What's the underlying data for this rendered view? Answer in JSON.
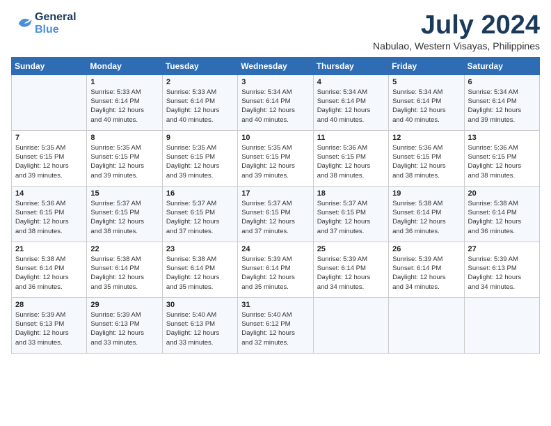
{
  "header": {
    "logo_line1": "General",
    "logo_line2": "Blue",
    "month_title": "July 2024",
    "location": "Nabulao, Western Visayas, Philippines"
  },
  "days_of_week": [
    "Sunday",
    "Monday",
    "Tuesday",
    "Wednesday",
    "Thursday",
    "Friday",
    "Saturday"
  ],
  "weeks": [
    [
      {
        "day": "",
        "info": ""
      },
      {
        "day": "1",
        "info": "Sunrise: 5:33 AM\nSunset: 6:14 PM\nDaylight: 12 hours\nand 40 minutes."
      },
      {
        "day": "2",
        "info": "Sunrise: 5:33 AM\nSunset: 6:14 PM\nDaylight: 12 hours\nand 40 minutes."
      },
      {
        "day": "3",
        "info": "Sunrise: 5:34 AM\nSunset: 6:14 PM\nDaylight: 12 hours\nand 40 minutes."
      },
      {
        "day": "4",
        "info": "Sunrise: 5:34 AM\nSunset: 6:14 PM\nDaylight: 12 hours\nand 40 minutes."
      },
      {
        "day": "5",
        "info": "Sunrise: 5:34 AM\nSunset: 6:14 PM\nDaylight: 12 hours\nand 40 minutes."
      },
      {
        "day": "6",
        "info": "Sunrise: 5:34 AM\nSunset: 6:14 PM\nDaylight: 12 hours\nand 39 minutes."
      }
    ],
    [
      {
        "day": "7",
        "info": "Sunrise: 5:35 AM\nSunset: 6:15 PM\nDaylight: 12 hours\nand 39 minutes."
      },
      {
        "day": "8",
        "info": "Sunrise: 5:35 AM\nSunset: 6:15 PM\nDaylight: 12 hours\nand 39 minutes."
      },
      {
        "day": "9",
        "info": "Sunrise: 5:35 AM\nSunset: 6:15 PM\nDaylight: 12 hours\nand 39 minutes."
      },
      {
        "day": "10",
        "info": "Sunrise: 5:35 AM\nSunset: 6:15 PM\nDaylight: 12 hours\nand 39 minutes."
      },
      {
        "day": "11",
        "info": "Sunrise: 5:36 AM\nSunset: 6:15 PM\nDaylight: 12 hours\nand 38 minutes."
      },
      {
        "day": "12",
        "info": "Sunrise: 5:36 AM\nSunset: 6:15 PM\nDaylight: 12 hours\nand 38 minutes."
      },
      {
        "day": "13",
        "info": "Sunrise: 5:36 AM\nSunset: 6:15 PM\nDaylight: 12 hours\nand 38 minutes."
      }
    ],
    [
      {
        "day": "14",
        "info": "Sunrise: 5:36 AM\nSunset: 6:15 PM\nDaylight: 12 hours\nand 38 minutes."
      },
      {
        "day": "15",
        "info": "Sunrise: 5:37 AM\nSunset: 6:15 PM\nDaylight: 12 hours\nand 38 minutes."
      },
      {
        "day": "16",
        "info": "Sunrise: 5:37 AM\nSunset: 6:15 PM\nDaylight: 12 hours\nand 37 minutes."
      },
      {
        "day": "17",
        "info": "Sunrise: 5:37 AM\nSunset: 6:15 PM\nDaylight: 12 hours\nand 37 minutes."
      },
      {
        "day": "18",
        "info": "Sunrise: 5:37 AM\nSunset: 6:15 PM\nDaylight: 12 hours\nand 37 minutes."
      },
      {
        "day": "19",
        "info": "Sunrise: 5:38 AM\nSunset: 6:14 PM\nDaylight: 12 hours\nand 36 minutes."
      },
      {
        "day": "20",
        "info": "Sunrise: 5:38 AM\nSunset: 6:14 PM\nDaylight: 12 hours\nand 36 minutes."
      }
    ],
    [
      {
        "day": "21",
        "info": "Sunrise: 5:38 AM\nSunset: 6:14 PM\nDaylight: 12 hours\nand 36 minutes."
      },
      {
        "day": "22",
        "info": "Sunrise: 5:38 AM\nSunset: 6:14 PM\nDaylight: 12 hours\nand 35 minutes."
      },
      {
        "day": "23",
        "info": "Sunrise: 5:38 AM\nSunset: 6:14 PM\nDaylight: 12 hours\nand 35 minutes."
      },
      {
        "day": "24",
        "info": "Sunrise: 5:39 AM\nSunset: 6:14 PM\nDaylight: 12 hours\nand 35 minutes."
      },
      {
        "day": "25",
        "info": "Sunrise: 5:39 AM\nSunset: 6:14 PM\nDaylight: 12 hours\nand 34 minutes."
      },
      {
        "day": "26",
        "info": "Sunrise: 5:39 AM\nSunset: 6:14 PM\nDaylight: 12 hours\nand 34 minutes."
      },
      {
        "day": "27",
        "info": "Sunrise: 5:39 AM\nSunset: 6:13 PM\nDaylight: 12 hours\nand 34 minutes."
      }
    ],
    [
      {
        "day": "28",
        "info": "Sunrise: 5:39 AM\nSunset: 6:13 PM\nDaylight: 12 hours\nand 33 minutes."
      },
      {
        "day": "29",
        "info": "Sunrise: 5:39 AM\nSunset: 6:13 PM\nDaylight: 12 hours\nand 33 minutes."
      },
      {
        "day": "30",
        "info": "Sunrise: 5:40 AM\nSunset: 6:13 PM\nDaylight: 12 hours\nand 33 minutes."
      },
      {
        "day": "31",
        "info": "Sunrise: 5:40 AM\nSunset: 6:12 PM\nDaylight: 12 hours\nand 32 minutes."
      },
      {
        "day": "",
        "info": ""
      },
      {
        "day": "",
        "info": ""
      },
      {
        "day": "",
        "info": ""
      }
    ]
  ]
}
